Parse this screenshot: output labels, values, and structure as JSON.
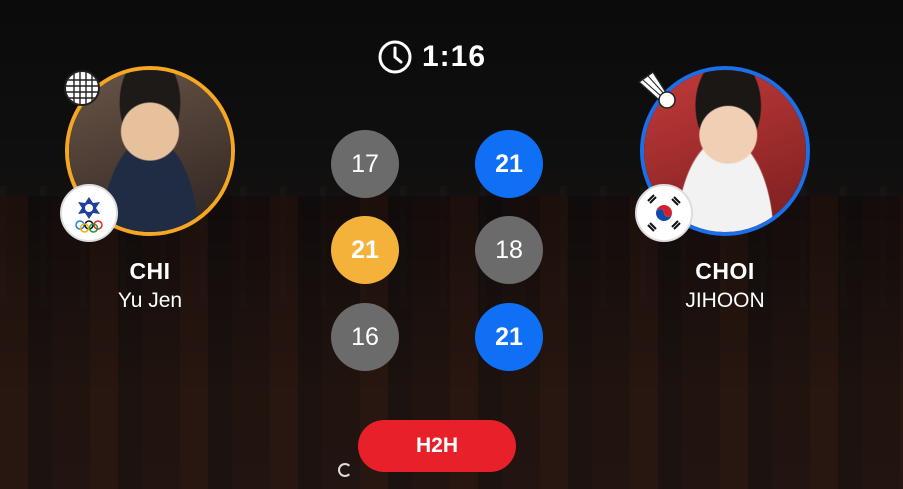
{
  "match": {
    "time": "1:16",
    "clock_icon": "clock-icon",
    "h2h_label": "H2H"
  },
  "players": {
    "left": {
      "last_name": "CHI",
      "first_name": "Yu Jen",
      "flag": "chinese-taipei-flag-icon",
      "indicator": "racket-icon",
      "ring_color": "#f5a623"
    },
    "right": {
      "last_name": "CHOI",
      "first_name": "JIHOON",
      "flag": "south-korea-flag-icon",
      "indicator": "shuttlecock-icon",
      "ring_color": "#1b6fe8"
    }
  },
  "games": [
    {
      "left": "17",
      "right": "21",
      "winner": "right"
    },
    {
      "left": "21",
      "right": "18",
      "winner": "left"
    },
    {
      "left": "16",
      "right": "21",
      "winner": "right"
    }
  ],
  "colors": {
    "left_win": "#f5b23a",
    "right_win": "#0f6ff5",
    "lose": "#6b6b6b",
    "h2h_button": "#e8202a"
  }
}
